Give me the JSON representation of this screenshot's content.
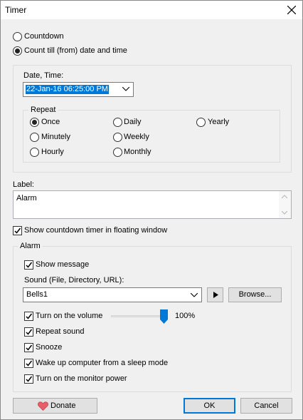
{
  "window": {
    "title": "Timer"
  },
  "mode": {
    "countdown_label": "Countdown",
    "count_till_label": "Count till (from) date and time",
    "selected": "count_till"
  },
  "datetime": {
    "label": "Date, Time:",
    "value": "22-Jan-16 06:25:00 PM"
  },
  "repeat": {
    "title": "Repeat",
    "options": [
      "Once",
      "Daily",
      "Yearly",
      "Minutely",
      "Weekly",
      "Hourly",
      "Monthly"
    ],
    "selected": "Once"
  },
  "label_field": {
    "label": "Label:",
    "value": "Alarm"
  },
  "floating_window": {
    "label": "Show countdown timer in floating window",
    "checked": true
  },
  "alarm": {
    "title": "Alarm",
    "show_message": {
      "label": "Show message",
      "checked": true
    },
    "sound_label": "Sound (File, Directory, URL):",
    "sound_value": "Bells1",
    "browse_label": "Browse...",
    "volume": {
      "label": "Turn on the volume",
      "checked": true,
      "level": 100,
      "text": "100%"
    },
    "repeat_sound": {
      "label": "Repeat sound",
      "checked": true
    },
    "snooze": {
      "label": "Snooze",
      "checked": true
    },
    "wake_up": {
      "label": "Wake up computer from a sleep mode",
      "checked": true
    },
    "monitor_power": {
      "label": "Turn on the monitor power",
      "checked": true
    }
  },
  "footer": {
    "donate_label": "Donate",
    "ok_label": "OK",
    "cancel_label": "Cancel"
  },
  "colors": {
    "selection": "#0078d7",
    "accent": "#0078d7",
    "heart": "#e85d6a"
  },
  "icons": {
    "close": "close-icon",
    "dropdown": "chevron-down-icon",
    "play": "play-icon",
    "heart": "heart-icon",
    "scroll_up": "scroll-up-icon",
    "scroll_down": "scroll-down-icon",
    "checkmark": "checkmark-icon"
  }
}
